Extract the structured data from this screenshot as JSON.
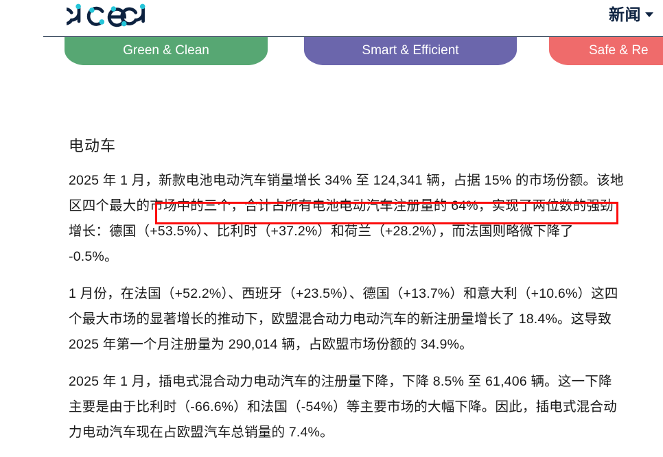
{
  "header": {
    "logo_text": "acea",
    "nav": {
      "label": "新闻",
      "caret_icon": "chevron-down-icon"
    }
  },
  "tabs": [
    {
      "label": "Green & Clean",
      "color": "#57a773"
    },
    {
      "label": "Smart & Efficient",
      "color": "#6b66ac"
    },
    {
      "label": "Safe & Re",
      "color": "#ef6b6b"
    }
  ],
  "tab_ghost_text": "Sa",
  "main": {
    "page_title": "电动车",
    "paragraphs": [
      "2025 年 1 月，新款电池电动汽车销量增长 34% 至 124,341 辆，占据 15% 的市场份额。该地区四个最大的市场中的三个，合计占所有电池电动汽车注册量的 64%，实现了两位数的强劲增长：德国（+53.5%）、比利时（+37.2%）和荷兰（+28.2%），而法国则略微下降了 -0.5%。",
      "1 月份，在法国（+52.2%）、西班牙（+23.5%）、德国（+13.7%）和意大利（+10.6%）这四个最大市场的显著增长的推动下，欧盟混合动力电动汽车的新注册量增长了 18.4%。这导致 2025 年第一个月注册量为 290,014 辆，占欧盟市场份额的 34.9%。",
      "2025 年 1 月，插电式混合动力电动汽车的注册量下降，下降 8.5% 至 61,406 辆。这一下降主要是由于比利时（-66.6%）和法国（-54%）等主要市场的大幅下降。因此，插电式混合动力电动汽车现在占欧盟汽车总销量的 7.4%。"
    ]
  },
  "annotation": {
    "highlight_color": "#fc0d0d",
    "highlight_text": "新款电池电动汽车销量增长 34% 至 124,341 辆，占据 15% 的市场份"
  }
}
